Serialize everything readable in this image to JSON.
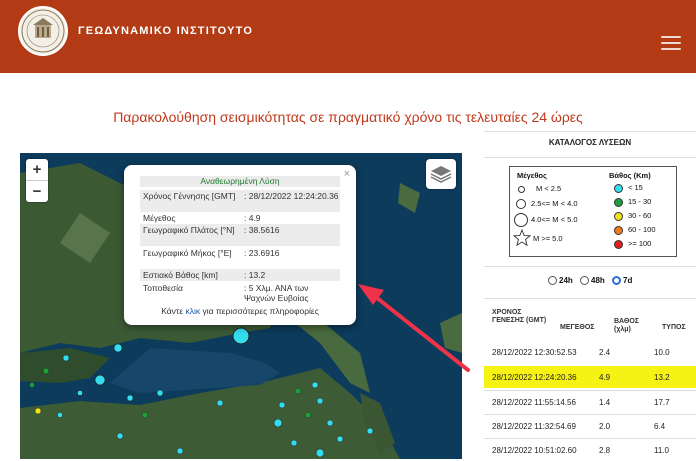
{
  "header": {
    "brand": "ΓΕΩΔΥΝΑΜΙΚΟ ΙΝΣΤΙΤΟΥΤΟ",
    "bg_color": "#b23a14"
  },
  "page_title": "Παρακολούθηση σεισμικότητας σε πραγματικό χρόνο τις τελευταίες 24 ώρες",
  "map": {
    "zoom_in": "+",
    "zoom_out": "−",
    "layers_icon": "layers-icon"
  },
  "popup": {
    "close": "×",
    "header": "Αναθεωρημένη Λύση",
    "rows": [
      {
        "label": "Χρόνος Γέννησης [GMT]",
        "value": ": 28/12/2022 12:24:20.36"
      },
      {
        "label": "Μέγεθος",
        "value": ": 4.9"
      },
      {
        "label": "Γεωγραφικό Πλάτος [°N]",
        "value": ": 38.5616"
      },
      {
        "label": "Γεωγραφικό Μήκος [°E]",
        "value": ": 23.6916"
      },
      {
        "label": "Εστιακό Βάθος [km]",
        "value": ": 13.2"
      },
      {
        "label": "Τοποθεσία",
        "value": ": 5 Χλμ. ΑΝΑ των Ψαχνών Ευβοίας"
      }
    ],
    "footer_pre": "Κάντε ",
    "footer_link": "κλικ",
    "footer_post": " για περισσότερες πληροφορίες"
  },
  "legend": {
    "title": "ΚΑΤΑΛΟΓΟΣ ΛΥΣΕΩΝ",
    "magnitude_title": "Μέγεθος",
    "depth_title": "Βάθος (Km)",
    "magnitudes": [
      "M < 2.5",
      "2.5<= M < 4.0",
      "4.0<= M < 5.0",
      "M >= 5.0"
    ],
    "depths": [
      {
        "label": "< 15",
        "color": "#33ddee"
      },
      {
        "label": "15 - 30",
        "color": "#1e9e3a"
      },
      {
        "label": "30 - 60",
        "color": "#f0e21a"
      },
      {
        "label": "60 - 100",
        "color": "#f07a1a"
      },
      {
        "label": ">= 100",
        "color": "#e02020"
      }
    ]
  },
  "period": {
    "options": [
      "24h",
      "48h",
      "7d"
    ],
    "selected": "7d"
  },
  "table": {
    "headers": {
      "time": "ΧΡΟΝΟΣ ΓΕΝΕΣΗΣ (GMT)",
      "magnitude": "ΜΕΓΕΘΟΣ",
      "depth": "ΒΑΘΟΣ (χλμ)",
      "type": "ΤΥΠΟΣ"
    },
    "rows": [
      {
        "time": "28/12/2022 12:30:52.53",
        "magnitude": "2.4",
        "depth": "10.0",
        "highlight": false
      },
      {
        "time": "28/12/2022 12:24:20.36",
        "magnitude": "4.9",
        "depth": "13.2",
        "highlight": true
      },
      {
        "time": "28/12/2022 11:55:14.56",
        "magnitude": "1.4",
        "depth": "17.7",
        "highlight": false
      },
      {
        "time": "28/12/2022 11:32:54.69",
        "magnitude": "2.0",
        "depth": "6.4",
        "highlight": false
      },
      {
        "time": "28/12/2022 10:51:02.60",
        "magnitude": "2.8",
        "depth": "11.0",
        "highlight": false
      }
    ]
  },
  "annotation_arrow_color": "#ee3348",
  "highlight_color": "#f5f214"
}
